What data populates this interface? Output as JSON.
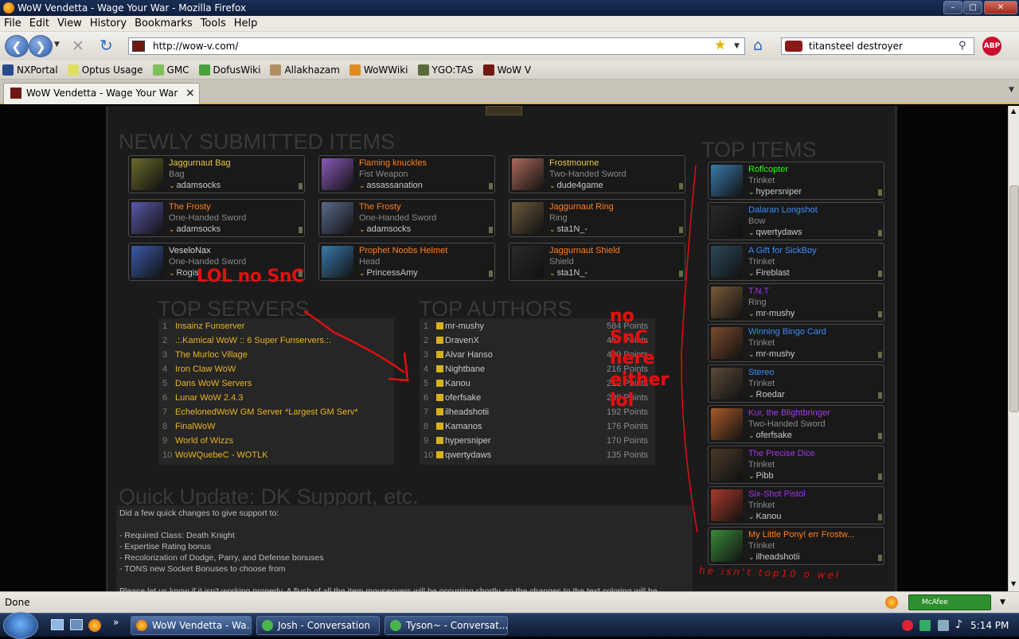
{
  "window": {
    "title": "WoW Vendetta - Wage Your War - Mozilla Firefox"
  },
  "menu": [
    "File",
    "Edit",
    "View",
    "History",
    "Bookmarks",
    "Tools",
    "Help"
  ],
  "nav": {
    "url": "http://wow-v.com/",
    "search": "titansteel destroyer",
    "abp_label": "ABP"
  },
  "bookmarks": [
    "NXPortal",
    "Optus Usage",
    "GMC",
    "DofusWiki",
    "Allakhazam",
    "WoWWiki",
    "YGO:TAS",
    "WoW V"
  ],
  "tab": {
    "title": "WoW Vendetta - Wage Your War",
    "close": "×"
  },
  "headings": {
    "newly": "NEWLY SUBMITTED ITEMS",
    "top_items": "TOP ITEMS",
    "top_servers": "TOP SERVERS",
    "top_authors": "TOP AUTHORS",
    "update": "Quick Update: DK Support, etc."
  },
  "new_items": [
    {
      "name": "Jaggurnaut Bag",
      "type": "Bag",
      "author": "adamsocks",
      "color": "#e8c84a"
    },
    {
      "name": "Flaming knuckles",
      "type": "Fist Weapon",
      "author": "assassanation",
      "color": "#ff7f1e"
    },
    {
      "name": "Frostmourne",
      "type": "Two-Handed Sword",
      "author": "dude4game",
      "color": "#e8c84a"
    },
    {
      "name": "The Frosty",
      "type": "One-Handed Sword",
      "author": "adamsocks",
      "color": "#ff7f1e"
    },
    {
      "name": "The Frosty",
      "type": "One-Handed Sword",
      "author": "adamsocks",
      "color": "#ff7f1e"
    },
    {
      "name": "Jaggurnaut Ring",
      "type": "Ring",
      "author": "sta1N_-",
      "color": "#ff7f1e"
    },
    {
      "name": "VeseloNax",
      "type": "One-Handed Sword",
      "author": "Rogis",
      "color": "#d8d8d8"
    },
    {
      "name": "Prophet Noobs Helmet",
      "type": "Head",
      "author": "PrincessAmy",
      "color": "#ff7f1e"
    },
    {
      "name": "Jaggurnaut Shield",
      "type": "Shield",
      "author": "sta1N_-",
      "color": "#ff7f1e"
    }
  ],
  "top_items": [
    {
      "name": "Roflcopter",
      "type": "Trinket",
      "author": "hypersniper",
      "color": "#1eff00"
    },
    {
      "name": "Dalaran Longshot",
      "type": "Bow",
      "author": "qwertydaws",
      "color": "#3a8eff"
    },
    {
      "name": "A Gift for SickBoy",
      "type": "Trinket",
      "author": "Fireblast",
      "color": "#3a8eff"
    },
    {
      "name": "T.N.T",
      "type": "Ring",
      "author": "mr-mushy",
      "color": "#a335ee"
    },
    {
      "name": "Winning Bingo Card",
      "type": "Trinket",
      "author": "mr-mushy",
      "color": "#3a8eff"
    },
    {
      "name": "Stereo",
      "type": "Trinket",
      "author": "Roedar",
      "color": "#3a8eff"
    },
    {
      "name": "Kur, the Blightbringer",
      "type": "Two-Handed Sword",
      "author": "oferfsake",
      "color": "#a335ee"
    },
    {
      "name": "The Precise Dice",
      "type": "Trinket",
      "author": "Pibb",
      "color": "#a335ee"
    },
    {
      "name": "Six-Shot Pistol",
      "type": "Trinket",
      "author": "Kanou",
      "color": "#a335ee"
    },
    {
      "name": "My Little Pony! err Frostw...",
      "type": "Trinket",
      "author": "ilheadshotii",
      "color": "#ff7f1e"
    }
  ],
  "top_servers": [
    {
      "rank": "1",
      "name": "Insainz Funserver"
    },
    {
      "rank": "2",
      "name": ".:.Kamical WoW :: 6 Super Funservers.:."
    },
    {
      "rank": "3",
      "name": "The Murloc Village"
    },
    {
      "rank": "4",
      "name": "Iron Claw WoW"
    },
    {
      "rank": "5",
      "name": "Dans WoW Servers"
    },
    {
      "rank": "6",
      "name": "Lunar WoW 2.4.3"
    },
    {
      "rank": "7",
      "name": "EchelonedWoW GM Server *Largest GM Serv*"
    },
    {
      "rank": "8",
      "name": "FinalWoW"
    },
    {
      "rank": "9",
      "name": "World of Wizzs"
    },
    {
      "rank": "10",
      "name": "WoWQuebeC - WOTLK"
    }
  ],
  "top_authors": [
    {
      "rank": "1",
      "name": "mr-mushy",
      "points": "584 Points"
    },
    {
      "rank": "2",
      "name": "DravenX",
      "points": "457 Points"
    },
    {
      "rank": "3",
      "name": "Alvar Hanso",
      "points": "409 Points"
    },
    {
      "rank": "4",
      "name": "Nightbane",
      "points": "216 Points"
    },
    {
      "rank": "5",
      "name": "Kanou",
      "points": "212 Points"
    },
    {
      "rank": "6",
      "name": "oferfsake",
      "points": "209 Points"
    },
    {
      "rank": "7",
      "name": "ilheadshotii",
      "points": "192 Points"
    },
    {
      "rank": "8",
      "name": "Kamanos",
      "points": "176 Points"
    },
    {
      "rank": "9",
      "name": "hypersniper",
      "points": "170 Points"
    },
    {
      "rank": "10",
      "name": "qwertydaws",
      "points": "135 Points"
    }
  ],
  "update_text": [
    "Did a few quick changes to give support to:",
    "",
    "- Required Class: Death Knight",
    "- Expertise Rating bonus",
    "- Recolorization of Dodge, Parry, and Defense bonuses",
    "- TONS new Socket Bonuses to choose from",
    "",
    "Please let us know if it isn't working properly. A flush of all the item mouseovers will be occurring shortly, so the changes to the text coloring will be"
  ],
  "annotations": {
    "lol": "LOL no SnC",
    "no_snc": [
      "no",
      "SnC",
      "here",
      "either",
      "lol"
    ],
    "scrawl": "he isn't top10 o wel"
  },
  "status": {
    "text": "Done",
    "mcafee": "McAfee SiteAdvisor"
  },
  "taskbar": {
    "tasks": [
      "WoW Vendetta - Wa...",
      "Josh - Conversation",
      "Tyson~ - Conversat..."
    ],
    "clock": "5:14 PM"
  }
}
